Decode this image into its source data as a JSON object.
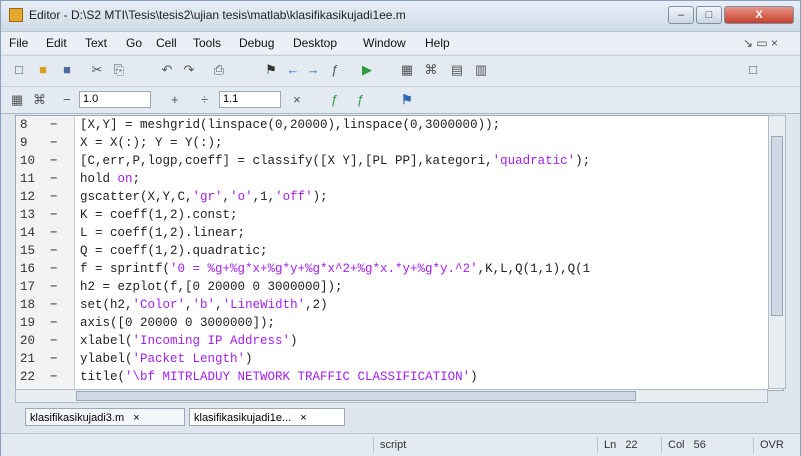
{
  "window": {
    "title": "Editor - D:\\S2 MTI\\Tesis\\tesis2\\ujian tesis\\matlab\\klasifikasikujadi1ee.m",
    "min": "–",
    "max": "□",
    "close": "X"
  },
  "menu": [
    "File",
    "Edit",
    "Text",
    "Go",
    "Cell",
    "Tools",
    "Debug",
    "Desktop",
    "Window",
    "Help"
  ],
  "menu_right": "↘ ▭ ×",
  "toolbar_icons": [
    "□",
    "■",
    "✂",
    "⎘",
    "↶",
    "↷",
    "⎙",
    "⚑",
    "←",
    "→",
    "ƒ",
    "▶",
    "▦",
    "⌘",
    "▤",
    "▥"
  ],
  "cellbar": {
    "value1": "1.0",
    "value2": "1.1",
    "minus": "−",
    "plus": "+",
    "divide": "÷",
    "times": "×"
  },
  "code_lines": [
    {
      "num": "8",
      "code": "[X,Y] = meshgrid(linspace(0,20000),linspace(0,3000000));"
    },
    {
      "num": "9",
      "code": "X = X(:); Y = Y(:);"
    },
    {
      "num": "10",
      "code": "[C,err,P,logp,coeff] = classify([X Y],[PL PP],kategori,'quadratic');"
    },
    {
      "num": "11",
      "code": "hold on;"
    },
    {
      "num": "12",
      "code": "gscatter(X,Y,C,'gr','o',1,'off');"
    },
    {
      "num": "13",
      "code": "K = coeff(1,2).const;"
    },
    {
      "num": "14",
      "code": "L = coeff(1,2).linear;"
    },
    {
      "num": "15",
      "code": "Q = coeff(1,2).quadratic;"
    },
    {
      "num": "16",
      "code": "f = sprintf('0 = %g+%g*x+%g*y+%g*x^2+%g*x.*y+%g*y.^2',K,L,Q(1,1),Q(1"
    },
    {
      "num": "17",
      "code": "h2 = ezplot(f,[0 20000 0 3000000]);"
    },
    {
      "num": "18",
      "code": "set(h2,'Color','b','LineWidth',2)"
    },
    {
      "num": "19",
      "code": "axis([0 20000 0 3000000]);"
    },
    {
      "num": "20",
      "code": "xlabel('Incoming IP Address')"
    },
    {
      "num": "21",
      "code": "ylabel('Packet Length')"
    },
    {
      "num": "22",
      "code": "title('\\bf MITRLADUY NETWORK TRAFFIC CLASSIFICATION')"
    }
  ],
  "tabs": [
    "klasifikasikujadi3.m",
    "klasifikasikujadi1e..."
  ],
  "tab_close": "×",
  "status": {
    "mode": "script",
    "ln_label": "Ln",
    "ln": "22",
    "col_label": "Col",
    "col": "56",
    "ovr": "OVR"
  }
}
